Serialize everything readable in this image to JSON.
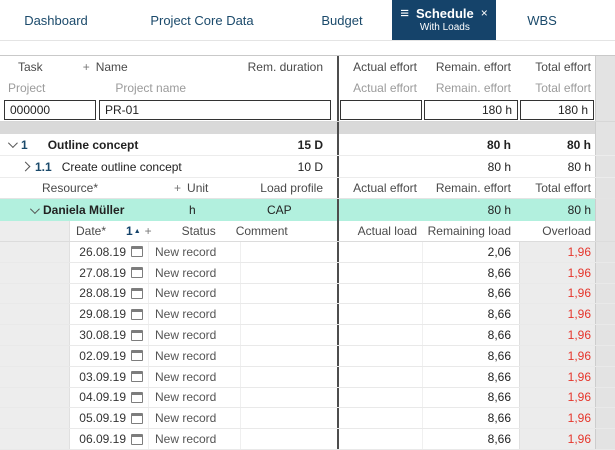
{
  "colors": {
    "accent_navy": "#15436a",
    "resource_highlight": "#b2f0de",
    "overload_red": "#e5352b"
  },
  "icons": {
    "hamburger": "≡",
    "close": "×",
    "plus": "+",
    "sort_asc": "▲"
  },
  "tabs": [
    {
      "label": "Dashboard"
    },
    {
      "label": "Project Core Data"
    },
    {
      "label": "Budget"
    },
    {
      "label": "Schedule",
      "sublabel": "With Loads"
    },
    {
      "label": "WBS"
    }
  ],
  "effort_headers": {
    "actual": "Actual effort",
    "remain": "Remain. effort",
    "total": "Total effort"
  },
  "task_header": {
    "task": "Task",
    "name": "Name",
    "rem_duration": "Rem. duration"
  },
  "project_header": {
    "project": "Project",
    "project_name": "Project name"
  },
  "project_row": {
    "id": "000000",
    "name": "PR-01",
    "actual": "",
    "remain": "180 h",
    "total": "180 h"
  },
  "tasks": [
    {
      "wbs": "1",
      "name": "Outline concept",
      "rem_duration": "15 D",
      "actual": "",
      "remain": "80 h",
      "total": "80 h"
    },
    {
      "wbs": "1.1",
      "name": "Create outline concept",
      "rem_duration": "10 D",
      "actual": "",
      "remain": "80 h",
      "total": "80 h"
    }
  ],
  "resource_header": {
    "resource": "Resource*",
    "unit": "Unit",
    "load_profile": "Load profile"
  },
  "resource_row": {
    "name": "Daniela Müller",
    "unit": "h",
    "load_profile": "CAP",
    "actual": "",
    "remain": "80 h",
    "total": "80 h"
  },
  "load_header": {
    "date": "Date*",
    "sort": "1",
    "status": "Status",
    "comment": "Comment",
    "actual_load": "Actual load",
    "remaining_load": "Remaining load",
    "overload": "Overload"
  },
  "load_rows": [
    {
      "date": "26.08.19",
      "status": "New record",
      "comment": "",
      "actual_load": "",
      "remaining_load": "2,06",
      "overload": "1,96"
    },
    {
      "date": "27.08.19",
      "status": "New record",
      "comment": "",
      "actual_load": "",
      "remaining_load": "8,66",
      "overload": "1,96"
    },
    {
      "date": "28.08.19",
      "status": "New record",
      "comment": "",
      "actual_load": "",
      "remaining_load": "8,66",
      "overload": "1,96"
    },
    {
      "date": "29.08.19",
      "status": "New record",
      "comment": "",
      "actual_load": "",
      "remaining_load": "8,66",
      "overload": "1,96"
    },
    {
      "date": "30.08.19",
      "status": "New record",
      "comment": "",
      "actual_load": "",
      "remaining_load": "8,66",
      "overload": "1,96"
    },
    {
      "date": "02.09.19",
      "status": "New record",
      "comment": "",
      "actual_load": "",
      "remaining_load": "8,66",
      "overload": "1,96"
    },
    {
      "date": "03.09.19",
      "status": "New record",
      "comment": "",
      "actual_load": "",
      "remaining_load": "8,66",
      "overload": "1,96"
    },
    {
      "date": "04.09.19",
      "status": "New record",
      "comment": "",
      "actual_load": "",
      "remaining_load": "8,66",
      "overload": "1,96"
    },
    {
      "date": "05.09.19",
      "status": "New record",
      "comment": "",
      "actual_load": "",
      "remaining_load": "8,66",
      "overload": "1,96"
    },
    {
      "date": "06.09.19",
      "status": "New record",
      "comment": "",
      "actual_load": "",
      "remaining_load": "8,66",
      "overload": "1,96"
    }
  ]
}
